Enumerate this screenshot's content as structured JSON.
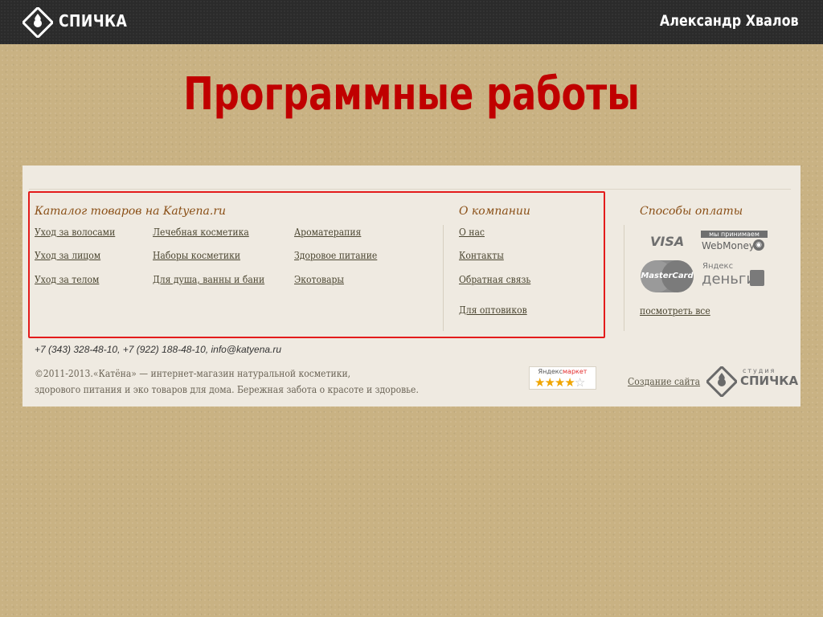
{
  "header": {
    "brand": "СПИЧКА",
    "author": "Александр Хвалов"
  },
  "slide": {
    "title": "Программные работы"
  },
  "footer": {
    "catalog_heading": "Каталог товаров на Katyena.ru",
    "catalog_links": [
      "Уход за волосами",
      "Уход за лицом",
      "Уход за телом",
      "Лечебная косметика",
      "Наборы косметики",
      "Для душа, ванны и бани",
      "Ароматерапия",
      "Здоровое питание",
      "Экотовары"
    ],
    "company_heading": "О компании",
    "company_links": [
      "О нас",
      "Контакты",
      "Обратная связь",
      "Для оптовиков"
    ],
    "payment_heading": "Способы оплаты",
    "payment": {
      "visa": "VISA",
      "webmoney_badge": "мы принимаем",
      "webmoney": "WebMoney",
      "mastercard": "MasterCard",
      "yandex_small": "Яндекс",
      "yandex_big": "деньги"
    },
    "see_all": "посмотреть все",
    "contacts": "+7 (343) 328-48-10, +7 (922) 188-48-10, info@katyena.ru",
    "copyright_line1": "©2011-2013.«Катёна» — интернет-магазин натуральной косметики,",
    "copyright_line2": "здорового питания и эко товаров для дома. Бережная забота о красоте и здоровье.",
    "market": {
      "brand": "Яндекс",
      "label": "маркет",
      "rating": 4,
      "max_rating": 5
    },
    "site_creation": "Создание сайта",
    "studio_small": "студия",
    "studio_big": "СПИЧКА"
  },
  "colors": {
    "title_red": "#c00000",
    "highlight": "#e31b1b",
    "heading_brown": "#8a4f16"
  }
}
